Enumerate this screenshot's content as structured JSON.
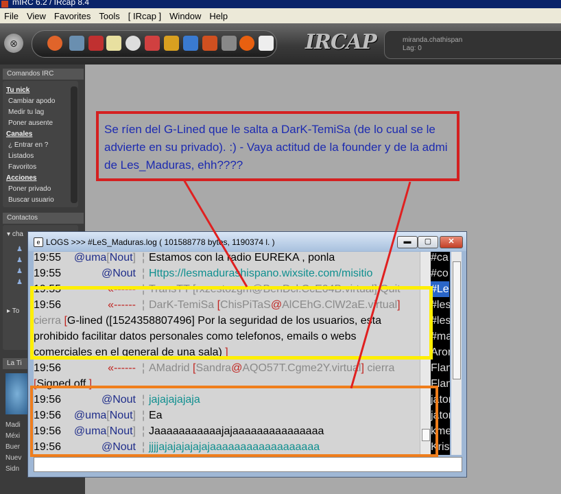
{
  "window": {
    "title": "mIRC 6.2 / IRcap 8.4"
  },
  "menu": [
    "File",
    "View",
    "Favorites",
    "Tools",
    "[ IRcap ]",
    "Window",
    "Help"
  ],
  "toolbar": {
    "close_symbol": "⊗",
    "logo": "IRCAP",
    "server": "miranda.chathispan",
    "lag": "Lag: 0"
  },
  "sidebar": {
    "commands_header": "Comandos IRC",
    "items": [
      {
        "label": "Tu nick",
        "heading": true
      },
      {
        "label": "Cambiar apodo"
      },
      {
        "label": "Medir tu lag"
      },
      {
        "label": "Poner ausente"
      },
      {
        "label": "Canales",
        "heading": true
      },
      {
        "label": "¿ Entrar en ?"
      },
      {
        "label": "Listados"
      },
      {
        "label": "Favoritos"
      },
      {
        "label": "Acciones",
        "heading": true
      },
      {
        "label": "Poner privado"
      },
      {
        "label": "Buscar usuario"
      }
    ],
    "contacts_header": "Contactos",
    "contacts": [
      "cha",
      "To"
    ],
    "weather_header": "La Ti",
    "cities": [
      "Madi",
      "Méxi",
      "Buer",
      "Nuev",
      "Sidn"
    ]
  },
  "annotation": {
    "text": "Se ríen del G-Lined que le salta a DarK-TemiSa (de lo cual se le advierte en su privado). :) - Vaya actitud de la founder y de la admi de Les_Maduras, ehh????",
    "color": "#d42020"
  },
  "log_window": {
    "title": "LOGS >>> #LeS_Maduras.log ( 101588778 bytes, 1190374 l. )",
    "buttons": {
      "minimize": "▬",
      "maximize": "▢",
      "close": "✕"
    },
    "lines": [
      {
        "time": "19:55",
        "nick_prefix": "@uma",
        "nick": "Nout",
        "sep": "¦",
        "text": "Estamos con la radio EUREKA , ponla"
      },
      {
        "time": "19:55",
        "nick": "@Nout",
        "sep": "¦",
        "text": "Https://lesmadurashispano.wixsite.com/misitio"
      },
      {
        "time": "19:55",
        "nick": "«------",
        "sep": "¦",
        "text": "TransTT [rxzestozgm@BenDcl.CcE04B.virtual] Quit"
      },
      {
        "time": "19:56",
        "nick": "«------",
        "sep": "¦",
        "actor": "DarK-TemiSa",
        "host_user": "ChisPiTaS",
        "host_at": "@",
        "host": "AlCEhG.ClW2aE.virtual",
        "action": "cierra",
        "reason_open": "[",
        "reason_prefix": "G-lined ([1524358807496] Por la seguridad de los usuarios, esta",
        "reason_line2": "prohibido facilitar datos personales como telefonos, emails o webs",
        "reason_line3": "comerciales en el general de una sala)",
        "reason_close": "]"
      },
      {
        "time": "19:56",
        "nick": "«------",
        "sep": "¦",
        "actor": "AMadrid",
        "host_user": "Sandra",
        "host_at": "@",
        "host": "AQO57T.Cgme2Y.virtual",
        "action": "cierra",
        "reason_open": "[",
        "reason_text": "Signed off",
        "reason_close": "]"
      },
      {
        "time": "19:56",
        "nick": "@Nout",
        "sep": "¦",
        "text": "jajajajajaja"
      },
      {
        "time": "19:56",
        "nick_prefix": "@uma",
        "nick": "Nout",
        "sep": "¦",
        "text": "Ea"
      },
      {
        "time": "19:56",
        "nick_prefix": "@uma",
        "nick": "Nout",
        "sep": "¦",
        "text": "Jaaaaaaaaaaajajaaaaaaaaaaaaaaa"
      },
      {
        "time": "19:56",
        "nick": "@Nout",
        "sep": "¦",
        "text": "jjjjajajajajajajaaaaaaaaaaaaaaaaaa"
      }
    ],
    "channels": [
      "#ca",
      "#co",
      "#Le",
      "#les",
      "#les",
      "#ma",
      "Aron",
      "Flan",
      "Flan",
      "jaton",
      "jaton",
      "kme",
      "Krist"
    ],
    "selected_channel_index": 2
  },
  "colors": {
    "highlight_yellow": "#ffef00",
    "highlight_orange": "#f07e1c",
    "nick_navy": "#1f2d8a",
    "url_teal": "#0f8f8f"
  }
}
